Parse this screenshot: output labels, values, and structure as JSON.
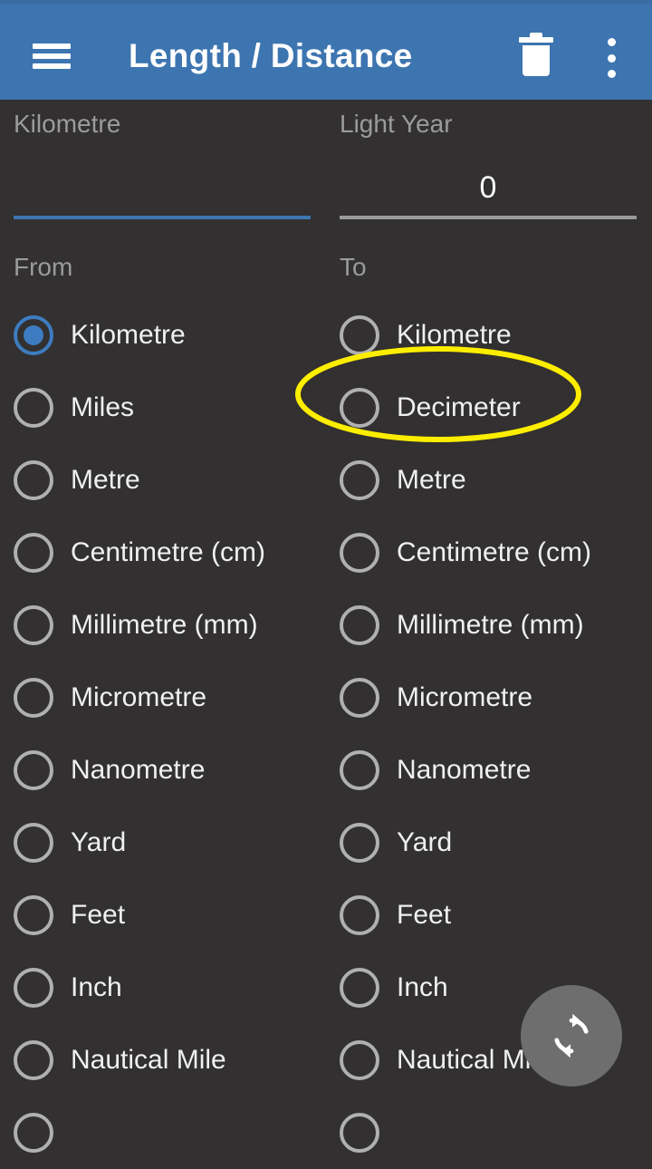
{
  "appbar": {
    "title": "Length / Distance",
    "menu_icon": "hamburger-menu-icon",
    "delete_icon": "trash-icon",
    "overflow_icon": "more-vertical-icon",
    "background_color": "#3d75b0"
  },
  "converter": {
    "from_field": {
      "label": "Kilometre",
      "value": "",
      "placeholder": "",
      "focused": true,
      "underline_color": "#3d75b0"
    },
    "to_field": {
      "label": "Light Year",
      "value": "0",
      "placeholder": "",
      "focused": false,
      "underline_color": "#9a9a9a"
    }
  },
  "from_column": {
    "header": "From",
    "selected_index": 0,
    "items": [
      {
        "label": "Kilometre",
        "selected": true
      },
      {
        "label": "Miles",
        "selected": false
      },
      {
        "label": "Metre",
        "selected": false
      },
      {
        "label": "Centimetre (cm)",
        "selected": false
      },
      {
        "label": "Millimetre (mm)",
        "selected": false
      },
      {
        "label": "Micrometre",
        "selected": false
      },
      {
        "label": "Nanometre",
        "selected": false
      },
      {
        "label": "Yard",
        "selected": false
      },
      {
        "label": "Feet",
        "selected": false
      },
      {
        "label": "Inch",
        "selected": false
      },
      {
        "label": "Nautical Mile",
        "selected": false
      },
      {
        "label": "",
        "selected": false
      }
    ]
  },
  "to_column": {
    "header": "To",
    "selected_index": -1,
    "items": [
      {
        "label": "Kilometre",
        "selected": false
      },
      {
        "label": "Decimeter",
        "selected": false
      },
      {
        "label": "Metre",
        "selected": false
      },
      {
        "label": "Centimetre (cm)",
        "selected": false
      },
      {
        "label": "Millimetre (mm)",
        "selected": false
      },
      {
        "label": "Micrometre",
        "selected": false
      },
      {
        "label": "Nanometre",
        "selected": false
      },
      {
        "label": "Yard",
        "selected": false
      },
      {
        "label": "Feet",
        "selected": false
      },
      {
        "label": "Inch",
        "selected": false
      },
      {
        "label": "Nautical Mile",
        "selected": false
      },
      {
        "label": "",
        "selected": false
      }
    ]
  },
  "fab": {
    "icon": "swap-refresh-icon",
    "color": "#6e6e6e"
  },
  "annotation": {
    "shape": "ellipse",
    "color": "#fdee00",
    "target": "Decimeter"
  },
  "theme": {
    "background": "#323030",
    "accent": "#3d75b0",
    "text_primary": "#f0f0f0",
    "text_secondary": "#9b9b9b",
    "radio_unselected": "#b0b0b0"
  }
}
